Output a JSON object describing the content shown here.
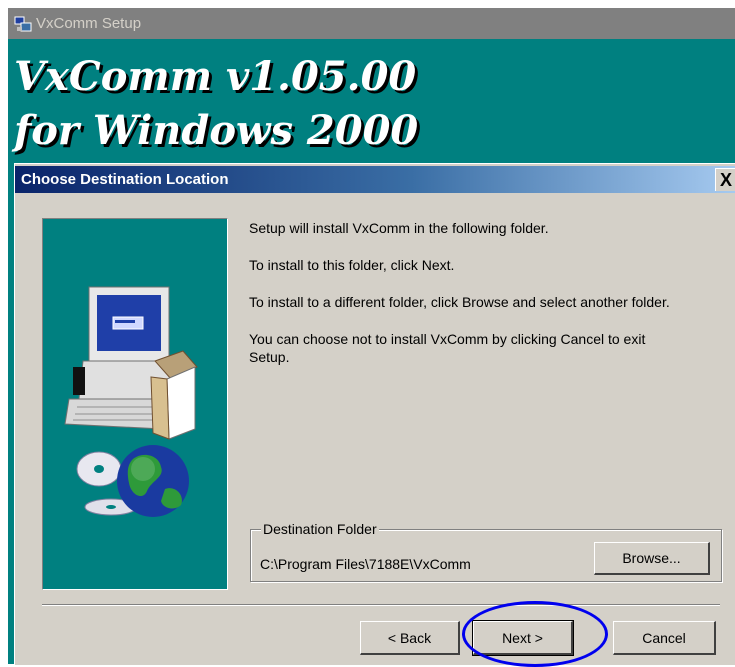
{
  "window": {
    "title": "VxComm Setup",
    "banner_line1": "VxComm v1.05.00",
    "banner_line2": "for Windows 2000"
  },
  "dialog": {
    "title": "Choose Destination Location",
    "close_label": "X",
    "messages": [
      "Setup will install VxComm in the following folder.",
      "To install to this folder, click Next.",
      "To install to a different folder, click Browse and select another folder.",
      "You can choose not to install VxComm by clicking Cancel to exit Setup."
    ],
    "destination": {
      "legend": "Destination Folder",
      "path": "C:\\Program Files\\7188E\\VxComm",
      "browse_label": "Browse..."
    },
    "buttons": {
      "back_label": "< Back",
      "next_label": "Next >",
      "cancel_label": "Cancel"
    }
  },
  "colors": {
    "backdrop": "#008080",
    "dialog_face": "#d4d0c8",
    "title_bar": "#0a246a",
    "highlight_ring": "#0000ee"
  },
  "icons": [
    "setup-app-icon",
    "computer-icon",
    "cd-disc-icon",
    "globe-icon"
  ]
}
